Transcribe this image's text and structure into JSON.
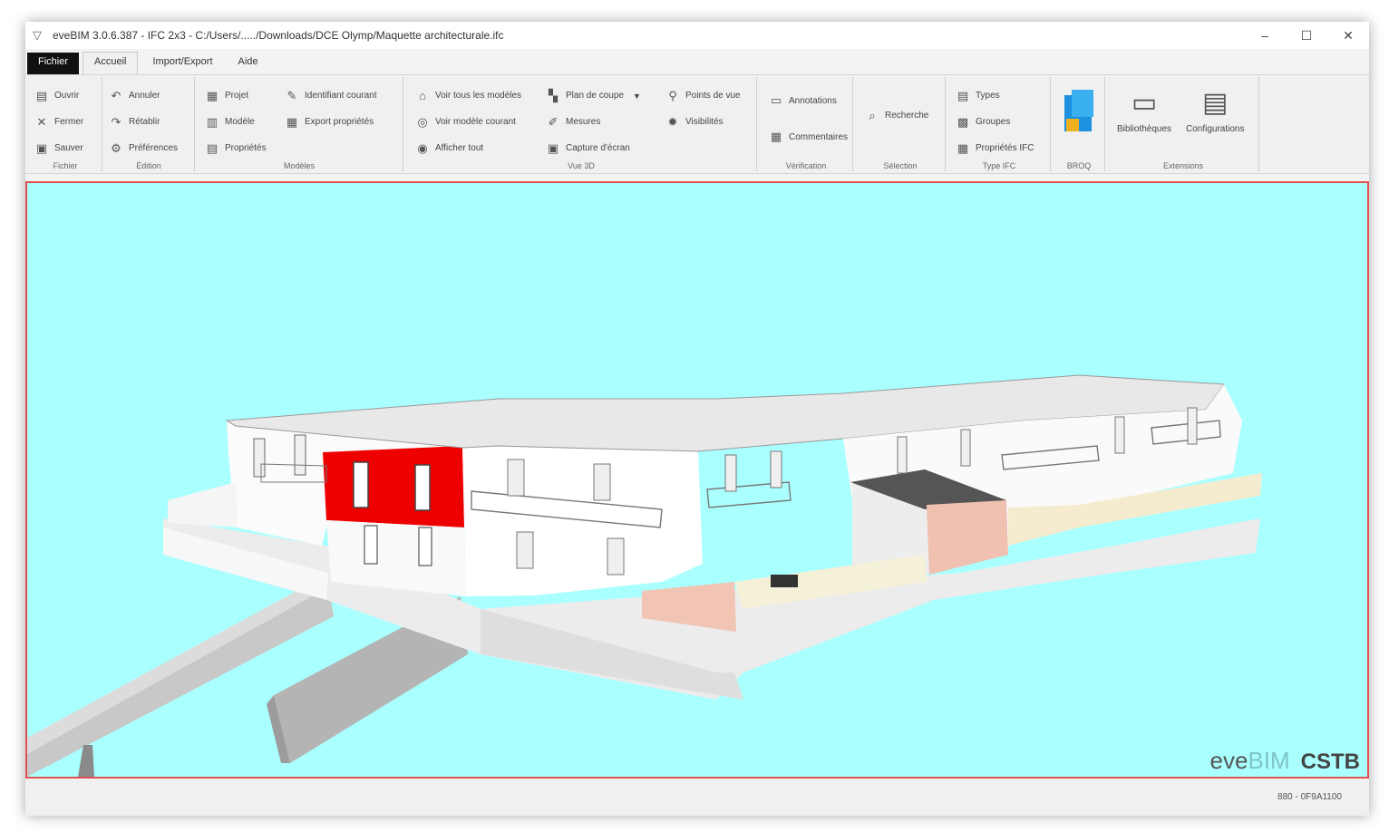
{
  "window": {
    "title": "eveBIM 3.0.6.387 - IFC 2x3 - C:/Users/...../Downloads/DCE Olymp/Maquette architecturale.ifc",
    "controls": {
      "minimize": "–",
      "maximize": "☐",
      "close": "✕"
    }
  },
  "menu": {
    "tabs": [
      {
        "label": "Fichier"
      },
      {
        "label": "Accueil"
      },
      {
        "label": "Import/Export"
      },
      {
        "label": "Aide"
      }
    ]
  },
  "ribbon": {
    "groups": [
      {
        "label": "Fichier",
        "buttons": [
          "Ouvrir",
          "Fermer",
          "Sauver"
        ]
      },
      {
        "label": "Édition",
        "buttons": [
          "Annuler",
          "Rétablir",
          "Préférences"
        ]
      },
      {
        "label": "Modèles",
        "buttons": [
          "Projet",
          "Modèle",
          "Propriétés",
          "Identifiant courant",
          "Export propriétés"
        ]
      },
      {
        "label": "Vue 3D",
        "buttons": [
          "Voir tous les modèles",
          "Voir modèle courant",
          "Afficher tout",
          "Plan de coupe",
          "Mesures",
          "Capture d'écran",
          "Points de vue",
          "Visibilités"
        ]
      },
      {
        "label": "Vérification",
        "buttons": [
          "Annotations",
          "Commentaires"
        ]
      },
      {
        "label": "Sélection",
        "buttons": [
          "Recherche"
        ]
      },
      {
        "label": "Type IFC",
        "buttons": [
          "Types",
          "Groupes",
          "Propriétés IFC"
        ]
      },
      {
        "label": "BROQ",
        "buttons": []
      },
      {
        "label": "Extensions",
        "buttons": [
          "Bibliothèques",
          "Configurations"
        ]
      }
    ]
  },
  "viewport": {
    "background": "#aaffff",
    "highlight_color": "#ee0000",
    "watermark": {
      "eve": "eve",
      "bim": "BIM",
      "cstb": "CSTB"
    }
  },
  "statusbar": {
    "text": "880 - 0F9A1100"
  }
}
